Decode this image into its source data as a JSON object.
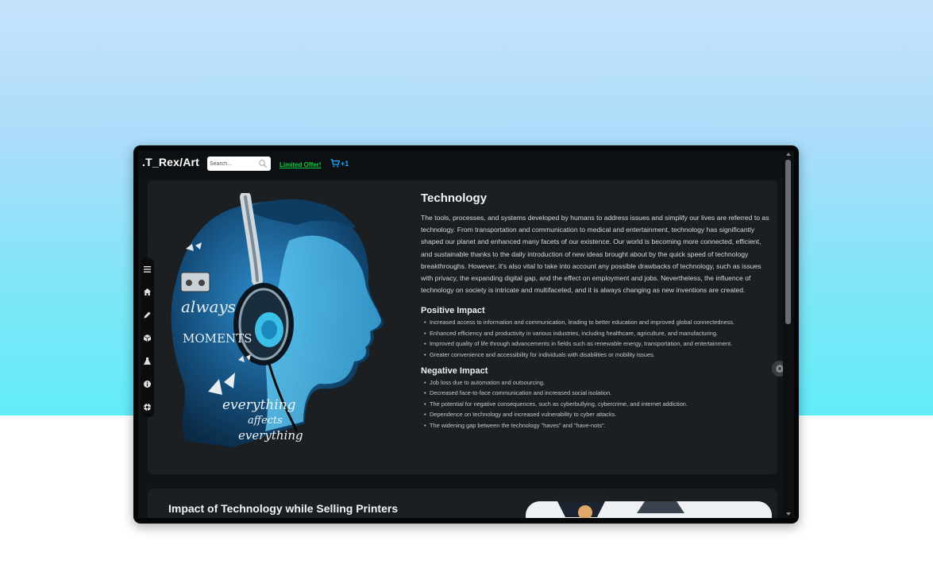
{
  "header": {
    "logo": ".T_Rex/Art",
    "search_placeholder": "Search...",
    "offer_link": "Limited Offer!",
    "cart_count": "+1"
  },
  "colors": {
    "offer_green": "#0fcf3c",
    "cart_blue": "#1aa9ff",
    "page_background": "#111416",
    "card_background": "#1c1f22"
  },
  "sidebar": {
    "icons": [
      "menu-icon",
      "home-icon",
      "pencil-icon",
      "cube-icon",
      "flask-icon",
      "info-icon",
      "settings-icon"
    ]
  },
  "article": {
    "title": "Technology",
    "intro": "The tools, processes, and systems developed by humans to address issues and simplify our lives are referred to as technology. From transportation and communication to medical and entertainment, technology has significantly shaped our planet and enhanced many facets of our existence. Our world is becoming more connected, efficient, and sustainable thanks to the daily introduction of new ideas brought about by the quick speed of technology breakthroughs. However, it's also vital to take into account any possible drawbacks of technology, such as issues with privacy, the expanding digital gap, and the effect on employment and jobs. Nevertheless, the influence of technology on society is intricate and multifaceted, and it is always changing as new inventions are created.",
    "positive_heading": "Positive Impact",
    "positive": [
      "Increased access to information and communication, leading to better education and improved global connectedness.",
      "Enhanced efficiency and productivity in various industries, including healthcare, agriculture, and manufacturing.",
      "Improved quality of life through advancements in fields such as renewable energy, transportation, and entertainment.",
      "Greater convenience and accessibility for individuals with disabilities or mobility issues."
    ],
    "negative_heading": "Negative Impact",
    "negative": [
      "Job loss due to automation and outsourcing.",
      "Decreased face-to-face communication and increased social isolation.",
      "The potential for negative consequences, such as cyberbullying, cybercrime, and internet addiction.",
      "Dependence on technology and increased vulnerability to cyber attacks.",
      "The widening gap between the technology \"haves\" and \"have-nots\"."
    ]
  },
  "section2": {
    "title": "Impact of Technology while Selling Printers"
  },
  "artwork": {
    "text_lines": [
      "always",
      "MOMENTS",
      "everything",
      "affects",
      "everything"
    ]
  }
}
